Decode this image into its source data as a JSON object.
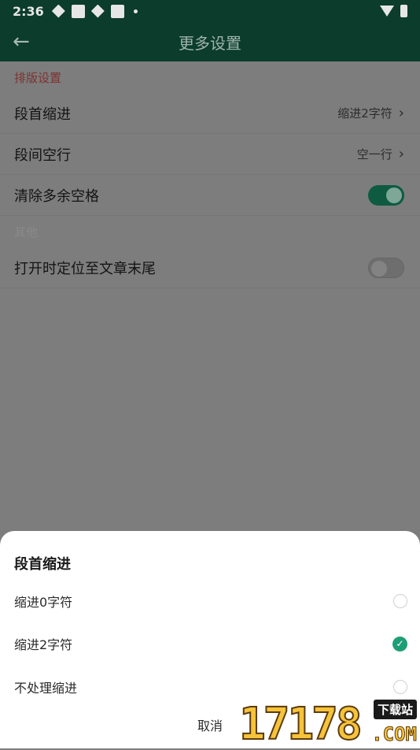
{
  "status_bar": {
    "time": "2:36"
  },
  "app_bar": {
    "back_icon": "arrow-left-icon",
    "title": "更多设置"
  },
  "sections": [
    {
      "header": "排版设置",
      "rows": [
        {
          "label": "段首缩进",
          "value": "缩进2字符",
          "type": "chevron"
        },
        {
          "label": "段间空行",
          "value": "空一行",
          "type": "chevron"
        },
        {
          "label": "清除多余空格",
          "type": "toggle",
          "enabled": true
        }
      ]
    },
    {
      "header": "其他",
      "rows": [
        {
          "label": "打开时定位至文章末尾",
          "type": "toggle",
          "enabled": false
        }
      ]
    }
  ],
  "sheet": {
    "title": "段首缩进",
    "options": [
      {
        "label": "缩进0字符",
        "selected": false
      },
      {
        "label": "缩进2字符",
        "selected": true
      },
      {
        "label": "不处理缩进",
        "selected": false
      }
    ],
    "cancel": "取消"
  },
  "watermark": {
    "number": "17178",
    "tag": "下载站",
    "domain": ".COM"
  },
  "colors": {
    "accent": "#1e9e77",
    "app_bar": "#0b3c2c",
    "section_header_red": "#c0393b"
  }
}
